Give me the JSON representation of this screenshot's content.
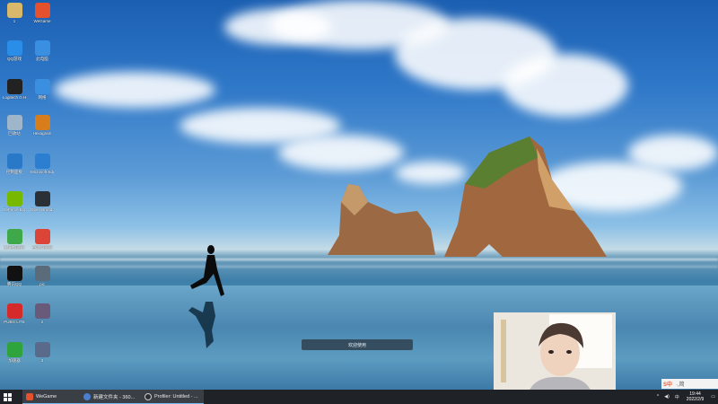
{
  "desktop_icons": [
    {
      "label": "1",
      "color": "#d8b86a",
      "glyph": "folder-icon"
    },
    {
      "label": "WeGame",
      "color": "#e5502d",
      "glyph": "wegame-icon"
    },
    {
      "label": "QQ游戏",
      "color": "#2a8ee8",
      "glyph": "game-icon"
    },
    {
      "label": "此电脑",
      "color": "#3b8fe0",
      "glyph": "computer-icon"
    },
    {
      "label": "Logitech G HUB",
      "color": "#222222",
      "glyph": "logitech-icon"
    },
    {
      "label": "网络",
      "color": "#3b8fe0",
      "glyph": "network-icon"
    },
    {
      "label": "回收站",
      "color": "#9fb5c9",
      "glyph": "recycle-bin-icon"
    },
    {
      "label": "Hexagram",
      "color": "#d77d1c",
      "glyph": "g-icon"
    },
    {
      "label": "控制面板",
      "color": "#2a79c9",
      "glyph": "control-panel-icon"
    },
    {
      "label": "Microsoft Edge",
      "color": "#2b7ed0",
      "glyph": "edge-icon"
    },
    {
      "label": "GeForce Experience",
      "color": "#76b900",
      "glyph": "nvidia-icon"
    },
    {
      "label": "Open Broadcaster Software",
      "color": "#2b2f36",
      "glyph": "obs-icon"
    },
    {
      "label": "腾讯加速器",
      "color": "#3ea84b",
      "glyph": "accelerator-icon"
    },
    {
      "label": "谷歌浏览器",
      "color": "#db4437",
      "glyph": "chrome-icon"
    },
    {
      "label": "腾讯QQ",
      "color": "#111111",
      "glyph": "qq-icon"
    },
    {
      "label": "pic",
      "color": "#5b6b7a",
      "glyph": "image-icon"
    },
    {
      "label": "PUBG LITE",
      "color": "#d42a2a",
      "glyph": "pubg-icon"
    },
    {
      "label": "2",
      "color": "#6a5a7a",
      "glyph": "photo-icon"
    },
    {
      "label": "加速器",
      "color": "#2fa33c",
      "glyph": "leaf-icon"
    },
    {
      "label": "3",
      "color": "#5a6a8a",
      "glyph": "photo-icon"
    }
  ],
  "center_pill": "欢迎使用",
  "taskbar": {
    "items": [
      {
        "label": "WeGame",
        "color": "#e5502d"
      },
      {
        "label": "新建文件夹 - 360...",
        "color": "#4a7fd0"
      },
      {
        "label": "Profiler: Untitled - ...",
        "color": "#2b2f36"
      }
    ],
    "tray": {
      "time": "19:44",
      "date": "2022/2/9",
      "lang": "中"
    }
  },
  "ime": {
    "label": "S中",
    "extra": "·,简"
  }
}
